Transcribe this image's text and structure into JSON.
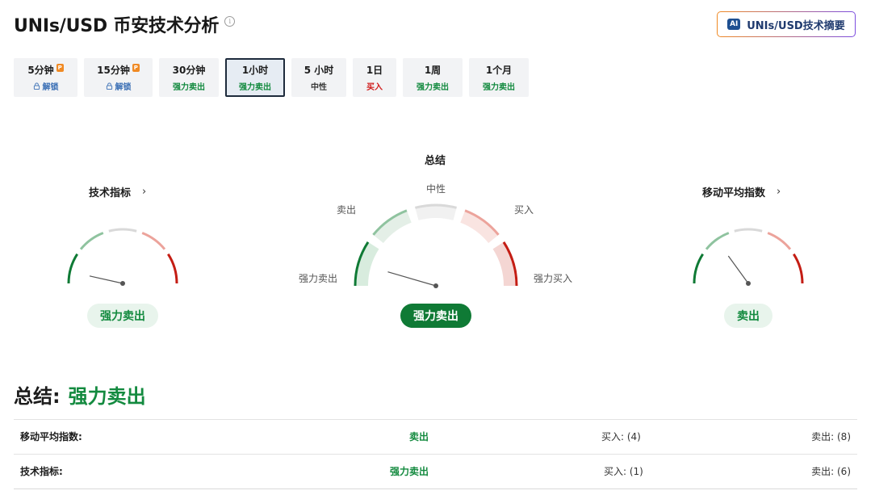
{
  "header": {
    "title": "UNIs/USD 币安技术分析",
    "info_icon": "info-icon",
    "ai_button_label": "UNIs/USD技术摘要",
    "ai_icon_text": "AI"
  },
  "timeframes": [
    {
      "label": "5分钟",
      "status": "解锁",
      "status_type": "locked",
      "pro": true
    },
    {
      "label": "15分钟",
      "status": "解锁",
      "status_type": "locked",
      "pro": true
    },
    {
      "label": "30分钟",
      "status": "强力卖出",
      "status_type": "sell"
    },
    {
      "label": "1小时",
      "status": "强力卖出",
      "status_type": "sell",
      "active": true
    },
    {
      "label": "5 小时",
      "status": "中性",
      "status_type": "neutral"
    },
    {
      "label": "1日",
      "status": "买入",
      "status_type": "buy"
    },
    {
      "label": "1周",
      "status": "强力卖出",
      "status_type": "sell"
    },
    {
      "label": "1个月",
      "status": "强力卖出",
      "status_type": "sell"
    }
  ],
  "gauges": {
    "technical": {
      "title": "技术指标",
      "reading": "强力卖出",
      "needle_level": 0.07
    },
    "summary": {
      "title": "总结",
      "reading": "强力卖出",
      "needle_level": 0.09,
      "labels": {
        "strong_sell": "强力卖出",
        "sell": "卖出",
        "neutral": "中性",
        "buy": "买入",
        "strong_buy": "强力买入"
      }
    },
    "moving_averages": {
      "title": "移动平均指数",
      "reading": "卖出",
      "needle_level": 0.3
    }
  },
  "summary": {
    "heading": "总结:",
    "value": "强力卖出",
    "rows": [
      {
        "name": "移动平均指数:",
        "signal": "卖出",
        "buy": "买入: (4)",
        "sell": "卖出: (8)"
      },
      {
        "name": "技术指标:",
        "signal": "强力卖出",
        "buy": "买入: (1)",
        "sell": "卖出: (6)"
      }
    ]
  },
  "colors": {
    "strong_sell": "#0f7a35",
    "sell": "#8fc39f",
    "neutral": "#d9d9d9",
    "buy": "#eca39b",
    "strong_buy": "#c41d14"
  }
}
